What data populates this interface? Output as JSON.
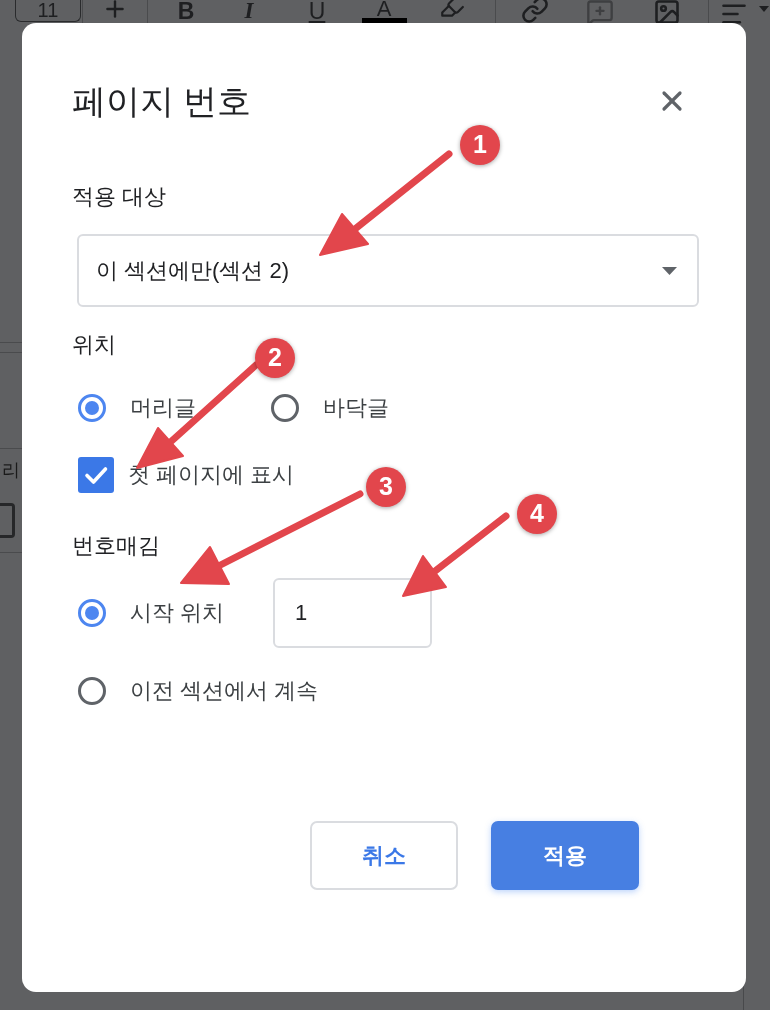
{
  "toolbar": {
    "font_size": "11",
    "format_marks": [
      "B",
      "I",
      "U",
      "A"
    ]
  },
  "document": {
    "text": "리",
    "checkbox": {
      "checked": false
    }
  },
  "dialog": {
    "title": "페이지 번호",
    "apply_to": {
      "label": "적용 대상",
      "value": "이 섹션에만(섹션 2)"
    },
    "position": {
      "label": "위치",
      "options": [
        {
          "label": "머리글",
          "selected": true
        },
        {
          "label": "바닥글",
          "selected": false
        }
      ],
      "show_on_first_page": {
        "label": "첫 페이지에 표시",
        "checked": true
      }
    },
    "numbering": {
      "label": "번호매김",
      "options": [
        {
          "kind": "start_at",
          "label": "시작 위치",
          "selected": true,
          "value": "1"
        },
        {
          "kind": "plain",
          "label": "이전 섹션에서 계속",
          "selected": false
        }
      ]
    },
    "buttons": [
      {
        "kind": "secondary",
        "label": "취소"
      },
      {
        "kind": "primary",
        "label": "적용"
      }
    ]
  },
  "annotations": [
    {
      "label": "1"
    },
    {
      "label": "2"
    },
    {
      "label": "3"
    },
    {
      "label": "4"
    }
  ]
}
